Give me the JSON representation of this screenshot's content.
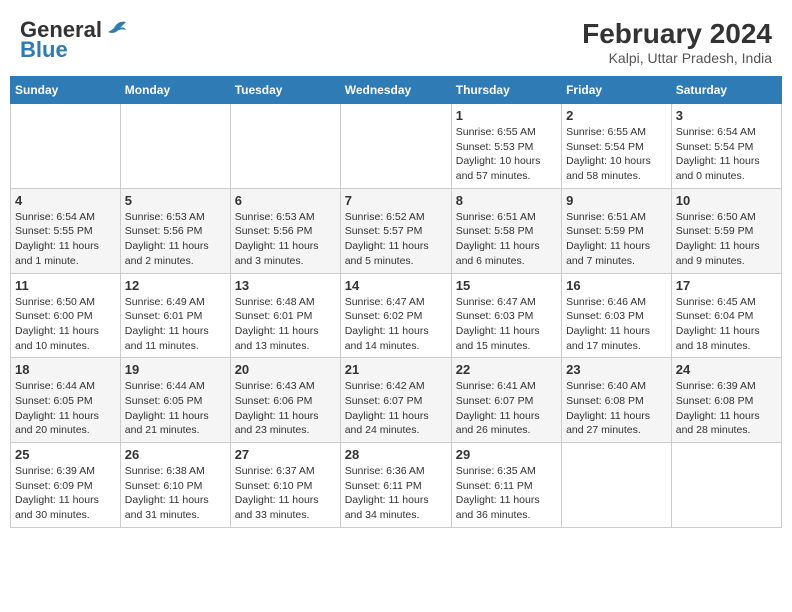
{
  "header": {
    "logo_general": "General",
    "logo_blue": "Blue",
    "month_year": "February 2024",
    "location": "Kalpi, Uttar Pradesh, India"
  },
  "columns": [
    "Sunday",
    "Monday",
    "Tuesday",
    "Wednesday",
    "Thursday",
    "Friday",
    "Saturday"
  ],
  "rows": [
    [
      {
        "day": "",
        "info": ""
      },
      {
        "day": "",
        "info": ""
      },
      {
        "day": "",
        "info": ""
      },
      {
        "day": "",
        "info": ""
      },
      {
        "day": "1",
        "info": "Sunrise: 6:55 AM\nSunset: 5:53 PM\nDaylight: 10 hours and 57 minutes."
      },
      {
        "day": "2",
        "info": "Sunrise: 6:55 AM\nSunset: 5:54 PM\nDaylight: 10 hours and 58 minutes."
      },
      {
        "day": "3",
        "info": "Sunrise: 6:54 AM\nSunset: 5:54 PM\nDaylight: 11 hours and 0 minutes."
      }
    ],
    [
      {
        "day": "4",
        "info": "Sunrise: 6:54 AM\nSunset: 5:55 PM\nDaylight: 11 hours and 1 minute."
      },
      {
        "day": "5",
        "info": "Sunrise: 6:53 AM\nSunset: 5:56 PM\nDaylight: 11 hours and 2 minutes."
      },
      {
        "day": "6",
        "info": "Sunrise: 6:53 AM\nSunset: 5:56 PM\nDaylight: 11 hours and 3 minutes."
      },
      {
        "day": "7",
        "info": "Sunrise: 6:52 AM\nSunset: 5:57 PM\nDaylight: 11 hours and 5 minutes."
      },
      {
        "day": "8",
        "info": "Sunrise: 6:51 AM\nSunset: 5:58 PM\nDaylight: 11 hours and 6 minutes."
      },
      {
        "day": "9",
        "info": "Sunrise: 6:51 AM\nSunset: 5:59 PM\nDaylight: 11 hours and 7 minutes."
      },
      {
        "day": "10",
        "info": "Sunrise: 6:50 AM\nSunset: 5:59 PM\nDaylight: 11 hours and 9 minutes."
      }
    ],
    [
      {
        "day": "11",
        "info": "Sunrise: 6:50 AM\nSunset: 6:00 PM\nDaylight: 11 hours and 10 minutes."
      },
      {
        "day": "12",
        "info": "Sunrise: 6:49 AM\nSunset: 6:01 PM\nDaylight: 11 hours and 11 minutes."
      },
      {
        "day": "13",
        "info": "Sunrise: 6:48 AM\nSunset: 6:01 PM\nDaylight: 11 hours and 13 minutes."
      },
      {
        "day": "14",
        "info": "Sunrise: 6:47 AM\nSunset: 6:02 PM\nDaylight: 11 hours and 14 minutes."
      },
      {
        "day": "15",
        "info": "Sunrise: 6:47 AM\nSunset: 6:03 PM\nDaylight: 11 hours and 15 minutes."
      },
      {
        "day": "16",
        "info": "Sunrise: 6:46 AM\nSunset: 6:03 PM\nDaylight: 11 hours and 17 minutes."
      },
      {
        "day": "17",
        "info": "Sunrise: 6:45 AM\nSunset: 6:04 PM\nDaylight: 11 hours and 18 minutes."
      }
    ],
    [
      {
        "day": "18",
        "info": "Sunrise: 6:44 AM\nSunset: 6:05 PM\nDaylight: 11 hours and 20 minutes."
      },
      {
        "day": "19",
        "info": "Sunrise: 6:44 AM\nSunset: 6:05 PM\nDaylight: 11 hours and 21 minutes."
      },
      {
        "day": "20",
        "info": "Sunrise: 6:43 AM\nSunset: 6:06 PM\nDaylight: 11 hours and 23 minutes."
      },
      {
        "day": "21",
        "info": "Sunrise: 6:42 AM\nSunset: 6:07 PM\nDaylight: 11 hours and 24 minutes."
      },
      {
        "day": "22",
        "info": "Sunrise: 6:41 AM\nSunset: 6:07 PM\nDaylight: 11 hours and 26 minutes."
      },
      {
        "day": "23",
        "info": "Sunrise: 6:40 AM\nSunset: 6:08 PM\nDaylight: 11 hours and 27 minutes."
      },
      {
        "day": "24",
        "info": "Sunrise: 6:39 AM\nSunset: 6:08 PM\nDaylight: 11 hours and 28 minutes."
      }
    ],
    [
      {
        "day": "25",
        "info": "Sunrise: 6:39 AM\nSunset: 6:09 PM\nDaylight: 11 hours and 30 minutes."
      },
      {
        "day": "26",
        "info": "Sunrise: 6:38 AM\nSunset: 6:10 PM\nDaylight: 11 hours and 31 minutes."
      },
      {
        "day": "27",
        "info": "Sunrise: 6:37 AM\nSunset: 6:10 PM\nDaylight: 11 hours and 33 minutes."
      },
      {
        "day": "28",
        "info": "Sunrise: 6:36 AM\nSunset: 6:11 PM\nDaylight: 11 hours and 34 minutes."
      },
      {
        "day": "29",
        "info": "Sunrise: 6:35 AM\nSunset: 6:11 PM\nDaylight: 11 hours and 36 minutes."
      },
      {
        "day": "",
        "info": ""
      },
      {
        "day": "",
        "info": ""
      }
    ]
  ]
}
